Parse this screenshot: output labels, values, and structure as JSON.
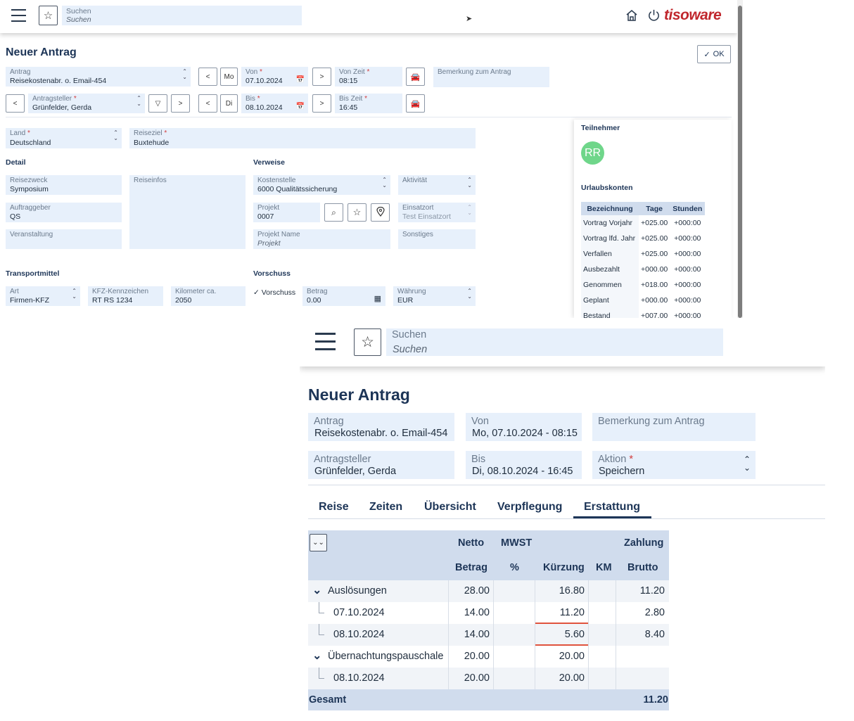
{
  "top": {
    "header": {
      "search_label": "Suchen",
      "search_placeholder": "Suchen",
      "brand": "tisoware"
    },
    "title": "Neuer Antrag",
    "ok_label": "OK",
    "antrag": {
      "label": "Antrag",
      "value": "Reisekostenabr. o. Email-454"
    },
    "antragsteller": {
      "label": "Antragsteller",
      "value": "Grünfelder, Gerda"
    },
    "day_von": "Mo",
    "day_bis": "Di",
    "von": {
      "label": "Von",
      "value": "07.10.2024"
    },
    "bis": {
      "label": "Bis",
      "value": "08.10.2024"
    },
    "von_zeit": {
      "label": "Von Zeit",
      "value": "08:15"
    },
    "bis_zeit": {
      "label": "Bis Zeit",
      "value": "16:45"
    },
    "bemerkung": {
      "label": "Bemerkung zum Antrag",
      "value": ""
    },
    "land": {
      "label": "Land",
      "value": "Deutschland"
    },
    "reiseziel": {
      "label": "Reiseziel",
      "value": "Buxtehude"
    },
    "detail": {
      "heading": "Detail",
      "reisezweck": {
        "label": "Reisezweck",
        "value": "Symposium"
      },
      "auftraggeber": {
        "label": "Auftraggeber",
        "value": "QS"
      },
      "veranstaltung": {
        "label": "Veranstaltung",
        "value": ""
      },
      "reiseinfos": {
        "label": "Reiseinfos",
        "value": ""
      }
    },
    "verweise": {
      "heading": "Verweise",
      "kostenstelle": {
        "label": "Kostenstelle",
        "value": "6000 Qualitätssicherung"
      },
      "aktivitaet": {
        "label": "Aktivität",
        "value": ""
      },
      "projekt": {
        "label": "Projekt",
        "value": "0007"
      },
      "einsatzort": {
        "label": "Einsatzort",
        "value": "Test Einsatzort"
      },
      "projekt_name": {
        "label": "Projekt Name",
        "placeholder": "Projekt"
      },
      "sonstiges": {
        "label": "Sonstiges",
        "value": ""
      }
    },
    "transport": {
      "heading": "Transportmittel",
      "art": {
        "label": "Art",
        "value": "Firmen-KFZ"
      },
      "kfz": {
        "label": "KFZ-Kennzeichen",
        "value": "RT RS 1234"
      },
      "km": {
        "label": "Kilometer ca.",
        "value": "2050"
      }
    },
    "vorschuss": {
      "heading": "Vorschuss",
      "checkbox_label": "Vorschuss",
      "betrag": {
        "label": "Betrag",
        "value": "0.00"
      },
      "waehrung": {
        "label": "Währung",
        "value": "EUR"
      }
    },
    "side": {
      "teilnehmer_heading": "Teilnehmer",
      "avatar_initials": "RR",
      "urlaub_heading": "Urlaubskonten",
      "columns": [
        "Bezeichnung",
        "Tage",
        "Stunden"
      ],
      "rows": [
        [
          "Vortrag Vorjahr",
          "+025.00",
          "+000:00"
        ],
        [
          "Vortrag lfd. Jahr",
          "+025.00",
          "+000:00"
        ],
        [
          "Verfallen",
          "+025.00",
          "+000:00"
        ],
        [
          "Ausbezahlt",
          "+000.00",
          "+000:00"
        ],
        [
          "Genommen",
          "+018.00",
          "+000:00"
        ],
        [
          "Geplant",
          "+000.00",
          "+000:00"
        ],
        [
          "Bestand",
          "+007.00",
          "+000:00"
        ]
      ]
    }
  },
  "bottom": {
    "search_label": "Suchen",
    "search_placeholder": "Suchen",
    "title": "Neuer Antrag",
    "antrag": {
      "label": "Antrag",
      "value": "Reisekostenabr. o. Email-454"
    },
    "von": {
      "label": "Von",
      "value": "Mo, 07.10.2024 - 08:15"
    },
    "bemerkung": {
      "label": "Bemerkung zum Antrag",
      "value": ""
    },
    "antragsteller": {
      "label": "Antragsteller",
      "value": "Grünfelder, Gerda"
    },
    "bis": {
      "label": "Bis",
      "value": "Di, 08.10.2024 - 16:45"
    },
    "aktion": {
      "label": "Aktion",
      "value": "Speichern"
    },
    "tabs": [
      "Reise",
      "Zeiten",
      "Übersicht",
      "Verpflegung",
      "Erstattung"
    ],
    "active_tab": "Erstattung",
    "table": {
      "header_top": {
        "netto": "Netto",
        "mwst": "MWST",
        "zahlung": "Zahlung"
      },
      "header_bottom": {
        "betrag": "Betrag",
        "pct": "%",
        "kuerzung": "Kürzung",
        "km": "KM",
        "brutto": "Brutto"
      },
      "rows": [
        {
          "label": "Auslösungen",
          "group": true,
          "betrag": "28.00",
          "pct": "",
          "kuerzung": "16.80",
          "km": "",
          "brutto": "11.20"
        },
        {
          "label": "07.10.2024",
          "group": false,
          "betrag": "14.00",
          "pct": "",
          "kuerzung": "11.20",
          "km": "",
          "brutto": "2.80"
        },
        {
          "label": "08.10.2024",
          "group": false,
          "betrag": "14.00",
          "pct": "",
          "kuerzung": "5.60",
          "km": "",
          "brutto": "8.40"
        },
        {
          "label": "Übernachtungspauschale",
          "group": true,
          "betrag": "20.00",
          "pct": "",
          "kuerzung": "20.00",
          "km": "",
          "brutto": ""
        },
        {
          "label": "08.10.2024",
          "group": false,
          "betrag": "20.00",
          "pct": "",
          "kuerzung": "20.00",
          "km": "",
          "brutto": ""
        }
      ],
      "total_label": "Gesamt",
      "total_value": "11.20"
    }
  },
  "colors": {
    "field_bg": "#e7f0fb",
    "accent_red": "#c0272d",
    "header_text": "#1d3557",
    "table_header_bg": "#d0dced",
    "avatar_green": "#6fd68a"
  }
}
